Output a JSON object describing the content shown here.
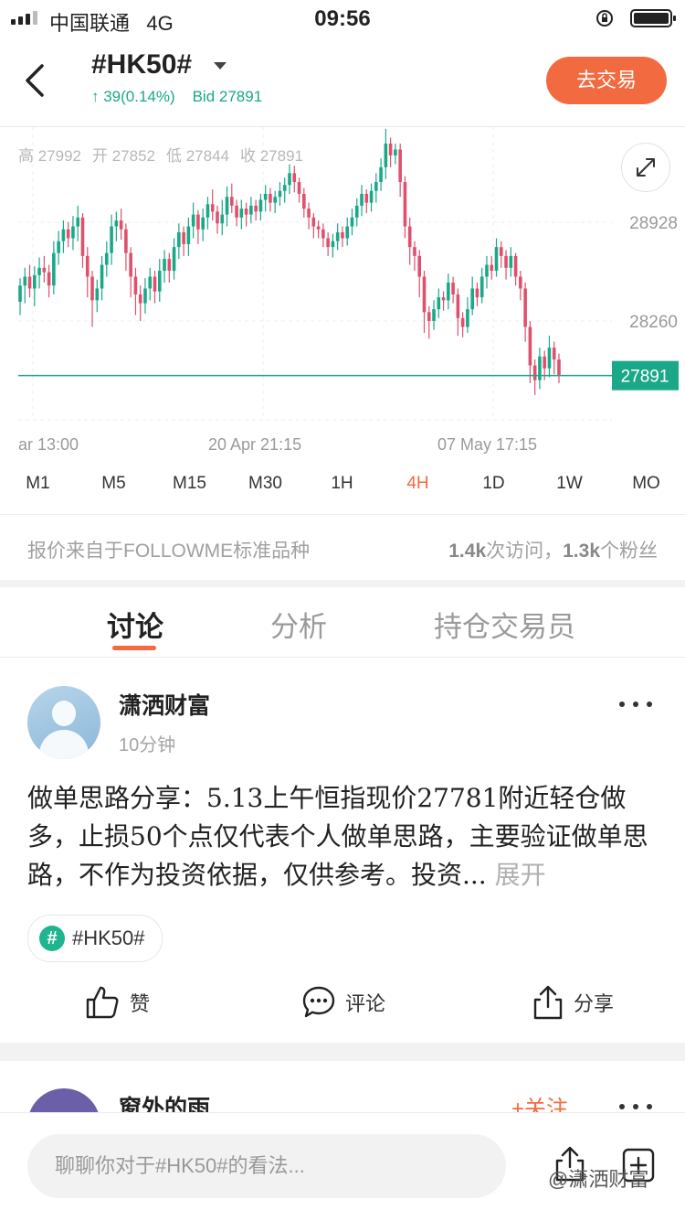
{
  "status_bar": {
    "carrier": "中国联通",
    "network": "4G",
    "time": "09:56"
  },
  "header": {
    "symbol": "#HK50#",
    "change": "↑ 39(0.14%)",
    "bid": "Bid 27891",
    "trade_button": "去交易"
  },
  "ohlc": {
    "high": "高 27992",
    "open": "开 27852",
    "low": "低 27844",
    "close": "收 27891"
  },
  "colors": {
    "up": "#1aa889",
    "down": "#e0506c",
    "accent": "#f26a3f",
    "price_line": "#1aa889"
  },
  "chart_data": {
    "type": "candlestick",
    "y_ticks": [
      "28928",
      "28260"
    ],
    "current_price": "27891",
    "x_labels": [
      "ar 13:00",
      "20 Apr 21:15",
      "07 May 17:15"
    ],
    "candles": [
      [
        28390,
        28500,
        28330,
        28550,
        28300
      ],
      [
        28500,
        28560,
        28420,
        28620,
        28380
      ],
      [
        28560,
        28480,
        28440,
        28640,
        28420
      ],
      [
        28480,
        28570,
        28390,
        28630,
        28360
      ],
      [
        28570,
        28620,
        28520,
        28690,
        28480
      ],
      [
        28620,
        28590,
        28550,
        28700,
        28520
      ],
      [
        28590,
        28500,
        28460,
        28640,
        28420
      ],
      [
        28500,
        28720,
        28480,
        28800,
        28440
      ],
      [
        28720,
        28800,
        28680,
        28870,
        28640
      ],
      [
        28800,
        28880,
        28760,
        28940,
        28720
      ],
      [
        28880,
        28820,
        28780,
        28930,
        28760
      ],
      [
        28820,
        28900,
        28780,
        28970,
        28740
      ],
      [
        28900,
        28960,
        28840,
        29040,
        28800
      ],
      [
        28960,
        28700,
        28660,
        28990,
        28620
      ],
      [
        28700,
        28560,
        28480,
        28760,
        28420
      ],
      [
        28560,
        28400,
        28300,
        28600,
        28220
      ],
      [
        28400,
        28480,
        28370,
        28540,
        28320
      ],
      [
        28480,
        28640,
        28440,
        28700,
        28400
      ],
      [
        28640,
        28720,
        28600,
        28800,
        28560
      ],
      [
        28720,
        28900,
        28680,
        28980,
        28640
      ],
      [
        28900,
        28940,
        28840,
        29000,
        28800
      ],
      [
        28940,
        28880,
        28850,
        29020,
        28810
      ],
      [
        28880,
        28720,
        28650,
        28920,
        28600
      ],
      [
        28720,
        28560,
        28500,
        28760,
        28420
      ],
      [
        28560,
        28440,
        28380,
        28620,
        28300
      ],
      [
        28440,
        28380,
        28330,
        28500,
        28260
      ],
      [
        28380,
        28480,
        28350,
        28550,
        28310
      ],
      [
        28480,
        28560,
        28440,
        28620,
        28400
      ],
      [
        28560,
        28460,
        28410,
        28600,
        28380
      ],
      [
        28460,
        28600,
        28420,
        28680,
        28390
      ],
      [
        28600,
        28680,
        28560,
        28740,
        28520
      ],
      [
        28680,
        28600,
        28550,
        28720,
        28520
      ],
      [
        28600,
        28760,
        28580,
        28820,
        28540
      ],
      [
        28760,
        28860,
        28720,
        28920,
        28680
      ],
      [
        28860,
        28780,
        28740,
        28900,
        28700
      ],
      [
        28780,
        28900,
        28750,
        28960,
        28700
      ],
      [
        28900,
        28980,
        28860,
        29060,
        28820
      ],
      [
        28980,
        28880,
        28840,
        29010,
        28780
      ],
      [
        28880,
        28960,
        28850,
        29020,
        28800
      ],
      [
        28960,
        29050,
        28920,
        29100,
        28880
      ],
      [
        29050,
        29000,
        28960,
        29150,
        28940
      ],
      [
        29000,
        28920,
        28880,
        29040,
        28850
      ],
      [
        28920,
        28980,
        28880,
        29080,
        28840
      ],
      [
        28980,
        29100,
        28940,
        29170,
        28900
      ],
      [
        29100,
        29040,
        29000,
        29190,
        28990
      ],
      [
        29040,
        28960,
        28920,
        29080,
        28900
      ],
      [
        28960,
        29020,
        28920,
        29080,
        28880
      ],
      [
        29020,
        28980,
        28940,
        29060,
        28900
      ],
      [
        28980,
        29040,
        28950,
        29100,
        28920
      ],
      [
        29040,
        29000,
        28960,
        29080,
        28940
      ],
      [
        29000,
        29080,
        28970,
        29120,
        28940
      ],
      [
        29080,
        29120,
        29040,
        29180,
        29000
      ],
      [
        29120,
        29060,
        29020,
        29160,
        29000
      ],
      [
        29060,
        29100,
        29020,
        29140,
        28990
      ],
      [
        29100,
        29140,
        29060,
        29200,
        29040
      ],
      [
        29140,
        29180,
        29100,
        29230,
        29060
      ],
      [
        29180,
        29260,
        29140,
        29320,
        29120
      ],
      [
        29260,
        29200,
        29160,
        29310,
        29130
      ],
      [
        29200,
        29120,
        29080,
        29230,
        29060
      ],
      [
        29120,
        29020,
        28980,
        29160,
        28960
      ],
      [
        29020,
        28960,
        28920,
        29060,
        28880
      ],
      [
        28960,
        28900,
        28860,
        28990,
        28820
      ],
      [
        28900,
        28880,
        28840,
        28940,
        28820
      ],
      [
        28880,
        28820,
        28780,
        28920,
        28760
      ],
      [
        28820,
        28760,
        28720,
        28860,
        28700
      ],
      [
        28760,
        28800,
        28720,
        28850,
        28690
      ],
      [
        28800,
        28860,
        28760,
        28920,
        28740
      ],
      [
        28860,
        28820,
        28780,
        28900,
        28760
      ],
      [
        28820,
        28900,
        28800,
        28960,
        28770
      ],
      [
        28900,
        28960,
        28860,
        29020,
        28840
      ],
      [
        28960,
        29040,
        28920,
        29090,
        28900
      ],
      [
        29040,
        29120,
        29000,
        29180,
        28970
      ],
      [
        29120,
        29060,
        29020,
        29150,
        28990
      ],
      [
        29060,
        29140,
        29020,
        29190,
        29000
      ],
      [
        29140,
        29200,
        29100,
        29260,
        29060
      ],
      [
        29200,
        29300,
        29160,
        29360,
        29140
      ],
      [
        29300,
        29460,
        29260,
        29560,
        29220
      ],
      [
        29460,
        29380,
        29340,
        29500,
        29300
      ],
      [
        29380,
        29420,
        29340,
        29460,
        29320
      ],
      [
        29420,
        29200,
        29160,
        29460,
        29100
      ],
      [
        29200,
        28900,
        28860,
        29240,
        28820
      ],
      [
        28900,
        28760,
        28700,
        28960,
        28640
      ],
      [
        28760,
        28700,
        28640,
        28800,
        28600
      ],
      [
        28700,
        28560,
        28480,
        28740,
        28420
      ],
      [
        28560,
        28320,
        28260,
        28600,
        28180
      ],
      [
        28320,
        28260,
        28200,
        28360,
        28140
      ],
      [
        28260,
        28340,
        28240,
        28400,
        28200
      ],
      [
        28340,
        28420,
        28320,
        28480,
        28280
      ],
      [
        28420,
        28400,
        28360,
        28460,
        28330
      ],
      [
        28400,
        28520,
        28380,
        28580,
        28340
      ],
      [
        28520,
        28440,
        28400,
        28560,
        28380
      ],
      [
        28440,
        28280,
        28220,
        28480,
        28160
      ],
      [
        28280,
        28220,
        28180,
        28320,
        28150
      ],
      [
        28220,
        28340,
        28200,
        28420,
        28180
      ],
      [
        28340,
        28480,
        28320,
        28560,
        28300
      ],
      [
        28480,
        28420,
        28380,
        28520,
        28360
      ],
      [
        28420,
        28560,
        28400,
        28620,
        28380
      ],
      [
        28560,
        28640,
        28520,
        28700,
        28480
      ],
      [
        28640,
        28600,
        28560,
        28700,
        28540
      ],
      [
        28600,
        28760,
        28580,
        28820,
        28560
      ],
      [
        28760,
        28700,
        28660,
        28800,
        28620
      ],
      [
        28700,
        28620,
        28580,
        28740,
        28540
      ],
      [
        28620,
        28700,
        28600,
        28760,
        28560
      ],
      [
        28700,
        28560,
        28520,
        28720,
        28500
      ],
      [
        28560,
        28480,
        28440,
        28600,
        28400
      ],
      [
        28480,
        28220,
        28160,
        28520,
        28120
      ],
      [
        28220,
        27960,
        27900,
        28260,
        27840
      ],
      [
        27960,
        27860,
        27820,
        28000,
        27760
      ],
      [
        27860,
        28020,
        27840,
        28080,
        27800
      ],
      [
        28020,
        27940,
        27900,
        28060,
        27860
      ],
      [
        27940,
        28080,
        27920,
        28160,
        27880
      ],
      [
        28080,
        28000,
        27960,
        28120,
        27900
      ],
      [
        28000,
        27891,
        27860,
        28040,
        27840
      ]
    ]
  },
  "timeframes": [
    "M1",
    "M5",
    "M15",
    "M30",
    "1H",
    "4H",
    "1D",
    "1W",
    "MO"
  ],
  "active_timeframe": "4H",
  "source_note": "报价来自于FOLLOWME标准品种",
  "stats": {
    "visits": "1.4k",
    "visits_label": "次访问，",
    "fans": "1.3k",
    "fans_label": "个粉丝"
  },
  "tabs": [
    "讨论",
    "分析",
    "持仓交易员"
  ],
  "post": {
    "author": "潇洒财富",
    "time": "10分钟",
    "body": "做单思路分享：5.13上午恒指现价27781附近轻仓做多，止损50个点仅代表个人做单思路，主要验证做单思路，不作为投资依据，仅供参考。投资...",
    "expand": "展开",
    "tag": "#HK50#",
    "actions": {
      "like": "赞",
      "comment": "评论",
      "share": "分享"
    }
  },
  "post2": {
    "author": "窗外的雨",
    "follow": "+关注"
  },
  "comment_placeholder": "聊聊你对于#HK50#的看法...",
  "watermark": "@潇洒财富"
}
